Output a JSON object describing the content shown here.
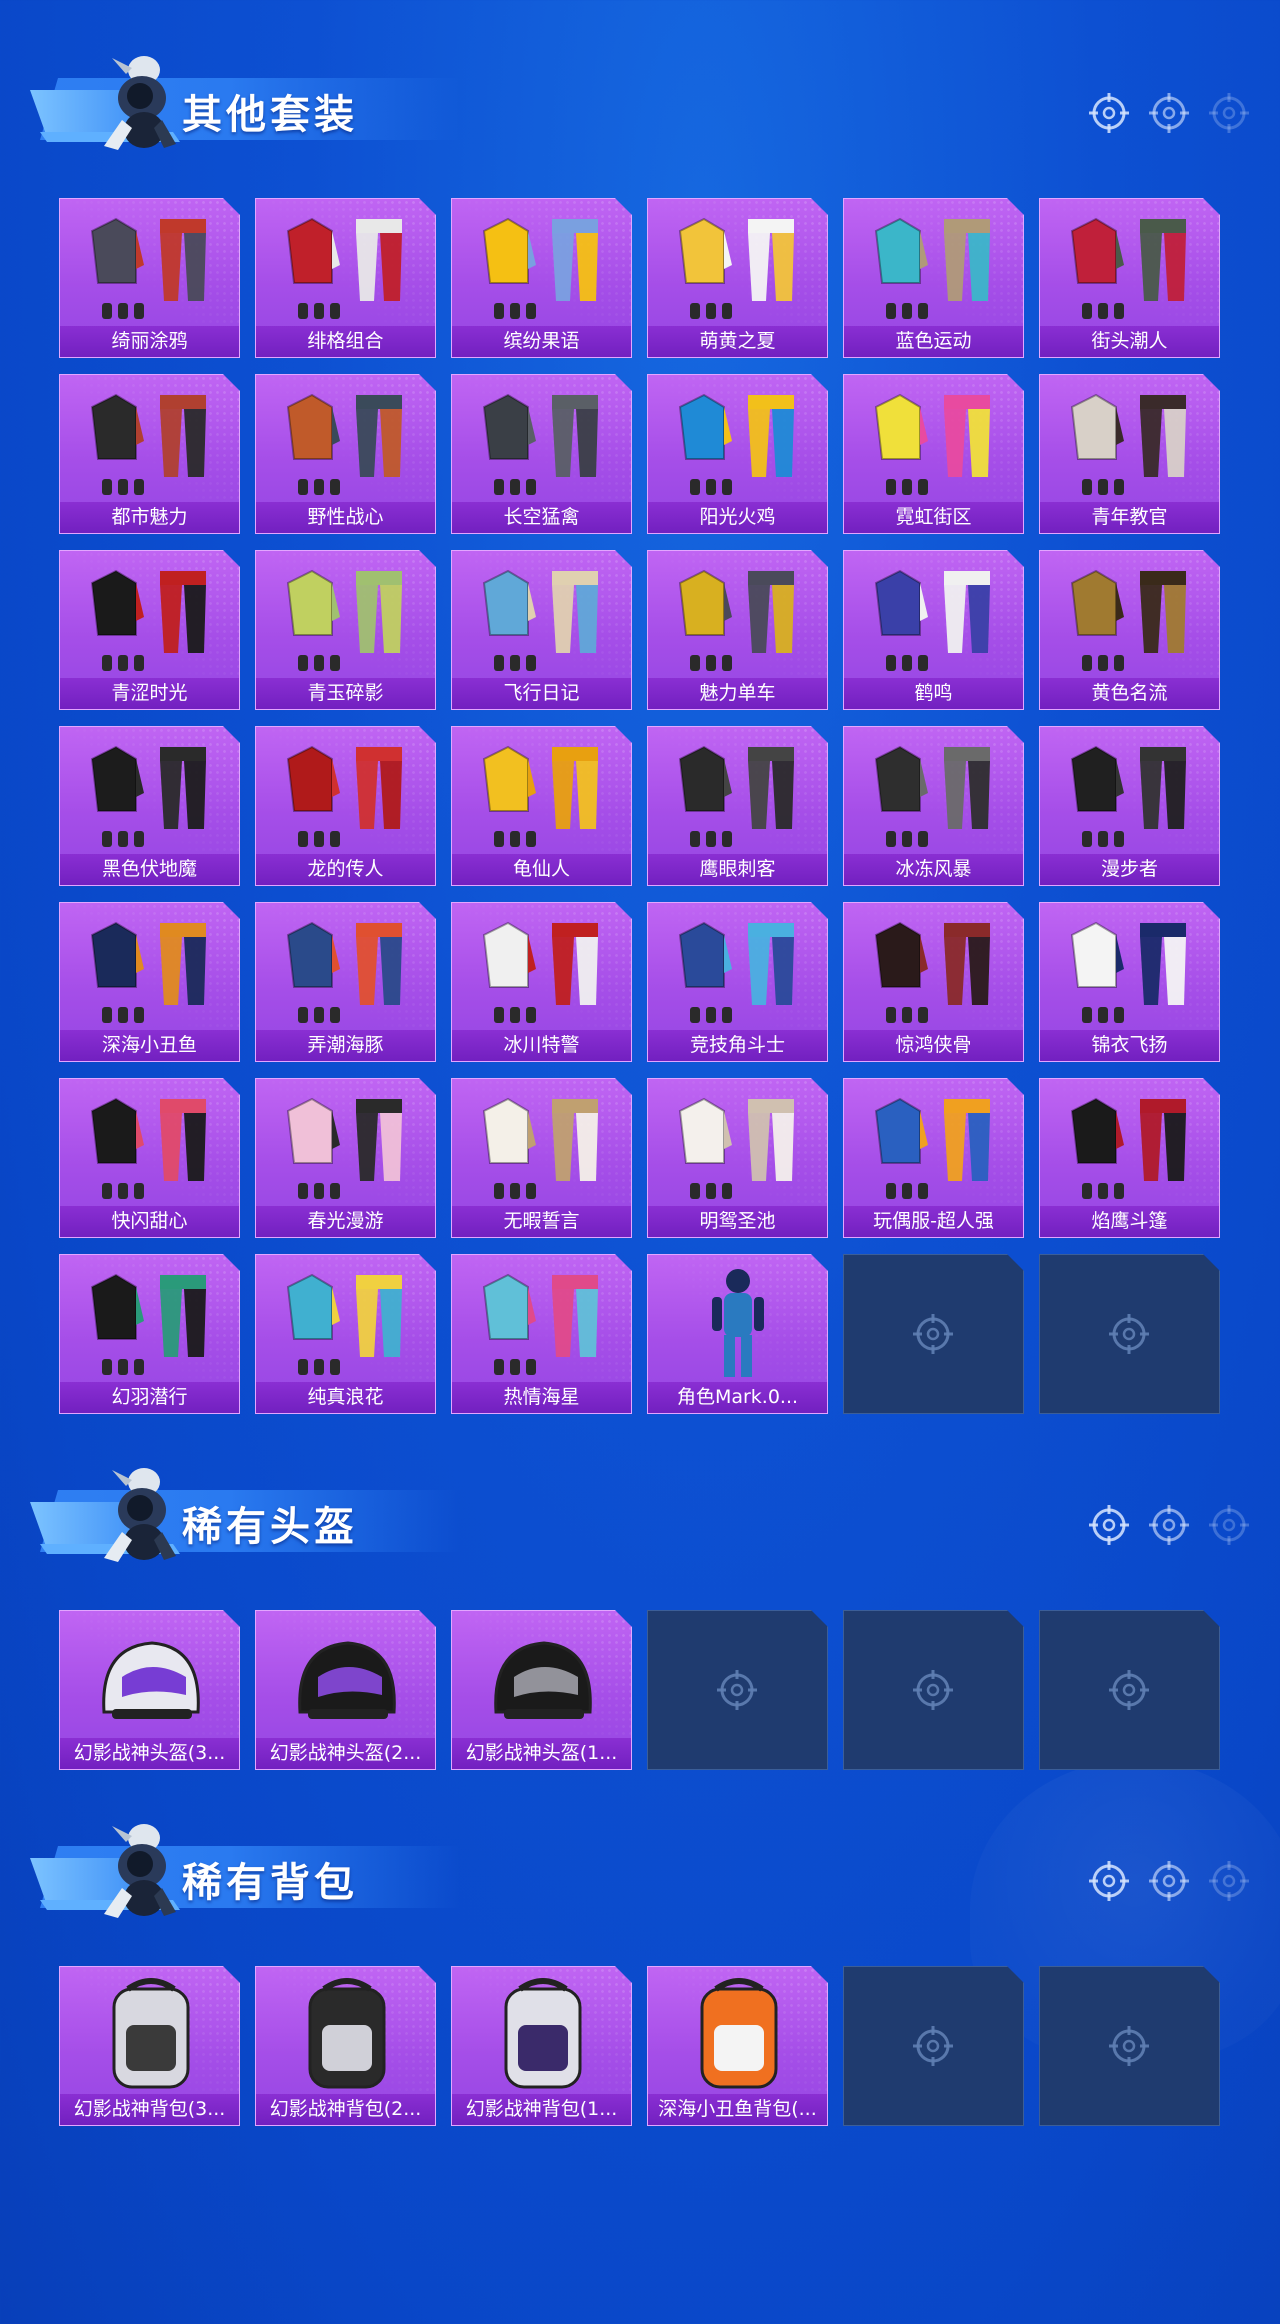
{
  "sections": [
    {
      "id": "other-outfits",
      "title": "其他套装",
      "items": [
        {
          "name": "绮丽涂鸦",
          "icon": "outfit-icon",
          "colors": [
            "#4a4a5a",
            "#c0392b"
          ]
        },
        {
          "name": "绯格组合",
          "icon": "outfit-icon",
          "colors": [
            "#c0202a",
            "#e8e8e8"
          ]
        },
        {
          "name": "缤纷果语",
          "icon": "outfit-icon",
          "colors": [
            "#f5c013",
            "#7aa0e0"
          ]
        },
        {
          "name": "萌黄之夏",
          "icon": "outfit-icon",
          "colors": [
            "#f2c43a",
            "#f4f4f4"
          ]
        },
        {
          "name": "蓝色运动",
          "icon": "outfit-icon",
          "colors": [
            "#3bb6c9",
            "#b09a78"
          ]
        },
        {
          "name": "街头潮人",
          "icon": "outfit-icon",
          "colors": [
            "#c0203a",
            "#4a5a4a"
          ]
        },
        {
          "name": "都市魅力",
          "icon": "outfit-icon",
          "colors": [
            "#2a2a2a",
            "#b04030"
          ]
        },
        {
          "name": "野性战心",
          "icon": "outfit-icon",
          "colors": [
            "#c05a2a",
            "#3a4a5a"
          ]
        },
        {
          "name": "长空猛禽",
          "icon": "outfit-icon",
          "colors": [
            "#3a3f46",
            "#5a5f66"
          ]
        },
        {
          "name": "阳光火鸡",
          "icon": "outfit-icon",
          "colors": [
            "#1f8ad6",
            "#f2c01a"
          ]
        },
        {
          "name": "霓虹街区",
          "icon": "outfit-icon",
          "colors": [
            "#f0e03a",
            "#e84aa0"
          ]
        },
        {
          "name": "青年教官",
          "icon": "outfit-icon",
          "colors": [
            "#d8d0c8",
            "#3a2a2a"
          ]
        },
        {
          "name": "青涩时光",
          "icon": "outfit-icon",
          "colors": [
            "#1a1a1a",
            "#c02020"
          ]
        },
        {
          "name": "青玉碎影",
          "icon": "outfit-icon",
          "colors": [
            "#c0d060",
            "#a0c070"
          ]
        },
        {
          "name": "飞行日记",
          "icon": "outfit-icon",
          "colors": [
            "#60a8d8",
            "#e0d0b0"
          ]
        },
        {
          "name": "魅力单车",
          "icon": "outfit-icon",
          "colors": [
            "#d8b020",
            "#4a4a5a"
          ]
        },
        {
          "name": "鹤鸣",
          "icon": "outfit-icon",
          "colors": [
            "#3a40a8",
            "#f0f0f0"
          ]
        },
        {
          "name": "黄色名流",
          "icon": "outfit-icon",
          "colors": [
            "#a07a30",
            "#3a2a1a"
          ]
        },
        {
          "name": "黑色伏地魔",
          "icon": "outfit-icon",
          "colors": [
            "#1c1c1c",
            "#2a2a2a"
          ]
        },
        {
          "name": "龙的传人",
          "icon": "outfit-icon",
          "colors": [
            "#b01a1a",
            "#d03030"
          ]
        },
        {
          "name": "龟仙人",
          "icon": "outfit-icon",
          "colors": [
            "#f2c020",
            "#e8a010"
          ]
        },
        {
          "name": "鹰眼刺客",
          "icon": "outfit-icon",
          "colors": [
            "#2a2a2a",
            "#444444"
          ]
        },
        {
          "name": "冰冻风暴",
          "icon": "outfit-icon",
          "colors": [
            "#2e2e2e",
            "#6a6a6a"
          ]
        },
        {
          "name": "漫步者",
          "icon": "outfit-icon",
          "colors": [
            "#202020",
            "#333333"
          ]
        },
        {
          "name": "深海小丑鱼",
          "icon": "outfit-icon",
          "colors": [
            "#1a2a5a",
            "#e08a20"
          ]
        },
        {
          "name": "弄潮海豚",
          "icon": "outfit-icon",
          "colors": [
            "#2a4a8a",
            "#e05030"
          ]
        },
        {
          "name": "冰川特警",
          "icon": "outfit-icon",
          "colors": [
            "#f0f0f0",
            "#c02020"
          ]
        },
        {
          "name": "竞技角斗士",
          "icon": "outfit-icon",
          "colors": [
            "#2a4a9a",
            "#4ab0e0"
          ]
        },
        {
          "name": "惊鸿侠骨",
          "icon": "outfit-icon",
          "colors": [
            "#2a1a1a",
            "#8a2a2a"
          ]
        },
        {
          "name": "锦衣飞扬",
          "icon": "outfit-icon",
          "colors": [
            "#f4f4f4",
            "#1a2a6a"
          ]
        },
        {
          "name": "快闪甜心",
          "icon": "outfit-icon",
          "colors": [
            "#1a1a1a",
            "#e04a6a"
          ]
        },
        {
          "name": "春光漫游",
          "icon": "outfit-icon",
          "colors": [
            "#f0c0d8",
            "#2a2a2a"
          ]
        },
        {
          "name": "无暇誓言",
          "icon": "outfit-icon",
          "colors": [
            "#f4f0e8",
            "#c0a070"
          ]
        },
        {
          "name": "明鸳圣池",
          "icon": "outfit-icon",
          "colors": [
            "#f4f0ec",
            "#d0c0b0"
          ]
        },
        {
          "name": "玩偶服-超人强",
          "icon": "outfit-icon",
          "colors": [
            "#2a60c0",
            "#f0a020"
          ]
        },
        {
          "name": "焰鹰斗篷",
          "icon": "outfit-icon",
          "colors": [
            "#1a1a1a",
            "#b01a2a"
          ]
        },
        {
          "name": "幻羽潜行",
          "icon": "outfit-icon",
          "colors": [
            "#1a1a1a",
            "#2a9a7a"
          ]
        },
        {
          "name": "纯真浪花",
          "icon": "outfit-icon",
          "colors": [
            "#40b0d0",
            "#f0d040"
          ]
        },
        {
          "name": "热情海星",
          "icon": "outfit-icon",
          "colors": [
            "#60c0d8",
            "#e04a8a"
          ]
        },
        {
          "name": "角色Mark.0...",
          "icon": "character-icon",
          "colors": [
            "#2a7ac0",
            "#1a2a5a"
          ]
        }
      ],
      "empty_slots": 2
    },
    {
      "id": "rare-helmets",
      "title": "稀有头盔",
      "items": [
        {
          "name": "幻影战神头盔(3...",
          "icon": "helmet-icon",
          "colors": [
            "#e8e8f0",
            "#6a2ad0"
          ]
        },
        {
          "name": "幻影战神头盔(2...",
          "icon": "helmet-icon",
          "colors": [
            "#1a1a1a",
            "#8a4ae0"
          ]
        },
        {
          "name": "幻影战神头盔(1...",
          "icon": "helmet-icon",
          "colors": [
            "#1a1a1a",
            "#a0a0a8"
          ]
        }
      ],
      "empty_slots": 3
    },
    {
      "id": "rare-backpacks",
      "title": "稀有背包",
      "items": [
        {
          "name": "幻影战神背包(3...",
          "icon": "backpack-icon",
          "colors": [
            "#d8d8e0",
            "#3a3a3a"
          ]
        },
        {
          "name": "幻影战神背包(2...",
          "icon": "backpack-icon",
          "colors": [
            "#2a2a2a",
            "#d0d0d8"
          ]
        },
        {
          "name": "幻影战神背包(1...",
          "icon": "backpack-icon",
          "colors": [
            "#e0e0e8",
            "#3a2a6a"
          ]
        },
        {
          "name": "深海小丑鱼背包(...",
          "icon": "backpack-icon",
          "colors": [
            "#f07020",
            "#f4f4f4"
          ]
        }
      ],
      "empty_slots": 2
    }
  ],
  "header_icons": [
    "crosshair-icon",
    "crosshair-icon",
    "crosshair-icon"
  ],
  "theme": {
    "card_purple": "#a54ee8",
    "label_purple": "#7a28c8",
    "empty_slot": "#1f3b6f",
    "background": "#0d50d2"
  }
}
